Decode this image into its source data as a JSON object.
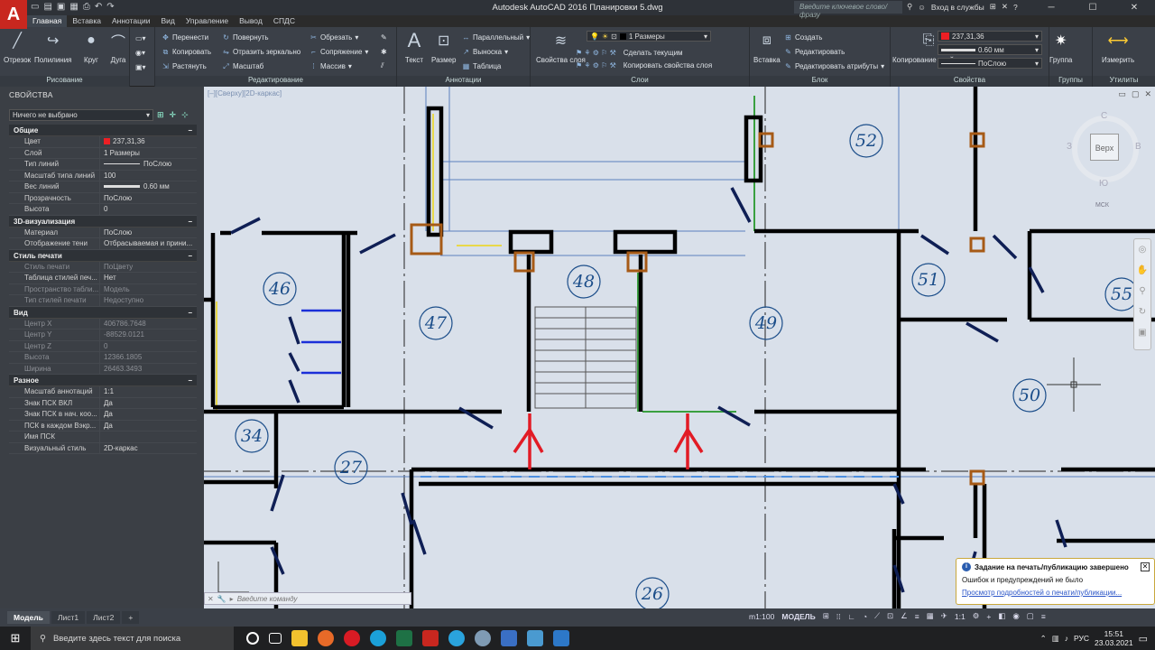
{
  "app": {
    "title": "Autodesk AutoCAD 2016   Планировки 5.dwg",
    "search_placeholder": "Введите ключевое слово/фразу",
    "login": "Вход в службы",
    "logo": "A"
  },
  "tabs": [
    "Главная",
    "Вставка",
    "Аннотации",
    "Вид",
    "Управление",
    "Вывод",
    "СПДС"
  ],
  "ribbon": {
    "draw": {
      "title": "Рисование",
      "buttons": [
        "Отрезок",
        "Полилиния",
        "Круг",
        "Дуга"
      ]
    },
    "modify": {
      "title": "Редактирование",
      "items": [
        "Перенести",
        "Копировать",
        "Растянуть",
        "Повернуть",
        "Отразить зеркально",
        "Масштаб",
        "Обрезать",
        "Сопряжение",
        "Массив"
      ]
    },
    "annot": {
      "title": "Аннотации",
      "buttons": [
        "Текст",
        "Размер"
      ],
      "items": [
        "Параллельный",
        "Выноска",
        "Таблица"
      ]
    },
    "layers": {
      "title": "Слои",
      "button": "Свойства слоя",
      "current": "1 Размеры",
      "items": [
        "Сделать текущим",
        "Копировать свойства слоя"
      ]
    },
    "block": {
      "title": "Блок",
      "button": "Вставка",
      "items": [
        "Создать",
        "Редактировать",
        "Редактировать атрибуты"
      ]
    },
    "props": {
      "title": "Свойства",
      "button": "Копирование свойств",
      "color": "237,31,36",
      "lineweight": "0.60 мм",
      "linetype": "ПоСлою"
    },
    "groups": {
      "title": "Группы",
      "button": "Группа"
    },
    "utils": {
      "title": "Утилиты",
      "button": "Измерить"
    }
  },
  "properties": {
    "header": "СВОЙСТВА",
    "selection": "Ничего не выбрано",
    "sections": [
      {
        "title": "Общие",
        "rows": [
          [
            "Цвет",
            "237,31,36"
          ],
          [
            "Слой",
            "1 Размеры"
          ],
          [
            "Тип линий",
            "ПоСлою"
          ],
          [
            "Масштаб типа линий",
            "100"
          ],
          [
            "Вес линий",
            "0.60 мм"
          ],
          [
            "Прозрачность",
            "ПоСлою"
          ],
          [
            "Высота",
            "0"
          ]
        ]
      },
      {
        "title": "3D-визуализация",
        "rows": [
          [
            "Материал",
            "ПоСлою"
          ],
          [
            "Отображение тени",
            "Отбрасываемая и прини..."
          ]
        ]
      },
      {
        "title": "Стиль печати",
        "rows": [
          [
            "Стиль печати",
            "ПоЦвету"
          ],
          [
            "Таблица стилей печ...",
            "Нет"
          ],
          [
            "Пространство табли...",
            "Модель"
          ],
          [
            "Тип стилей печати",
            "Недоступно"
          ]
        ]
      },
      {
        "title": "Вид",
        "rows": [
          [
            "Центр X",
            "406786.7648"
          ],
          [
            "Центр Y",
            "-88529.0121"
          ],
          [
            "Центр Z",
            "0"
          ],
          [
            "Высота",
            "12366.1805"
          ],
          [
            "Ширина",
            "26463.3493"
          ]
        ]
      },
      {
        "title": "Разное",
        "rows": [
          [
            "Масштаб аннотаций",
            "1:1"
          ],
          [
            "Знак ПСК ВКЛ",
            "Да"
          ],
          [
            "Знак ПСК в нач. коо...",
            "Да"
          ],
          [
            "ПСК в каждом Вэкр...",
            "Да"
          ],
          [
            "Имя ПСК",
            ""
          ],
          [
            "Визуальный стиль",
            "2D-каркас"
          ]
        ]
      }
    ]
  },
  "viewport": {
    "label": "[–][Сверху][2D-каркас]",
    "viewcube": "Верх",
    "compass": [
      "С",
      "В",
      "Ю",
      "З"
    ],
    "ucs": "МСК",
    "rooms": [
      "52",
      "46",
      "47",
      "48",
      "49",
      "51",
      "55",
      "50",
      "34",
      "27",
      "26"
    ]
  },
  "command": {
    "placeholder": "Введите команду"
  },
  "notification": {
    "title": "Задание на печать/публикацию завершено",
    "body": "Ошибок и предупреждений не было",
    "link": "Просмотр подробностей о печати/публикации..."
  },
  "status": {
    "tabs": [
      "Модель",
      "Лист1",
      "Лист2"
    ],
    "scale": "m1:100",
    "mode": "МОДЕЛЬ",
    "annot_scale": "1:1"
  },
  "taskbar": {
    "search": "Введите здесь текст для поиска",
    "lang": "РУС",
    "time": "15:51",
    "date": "23.03.2021"
  }
}
